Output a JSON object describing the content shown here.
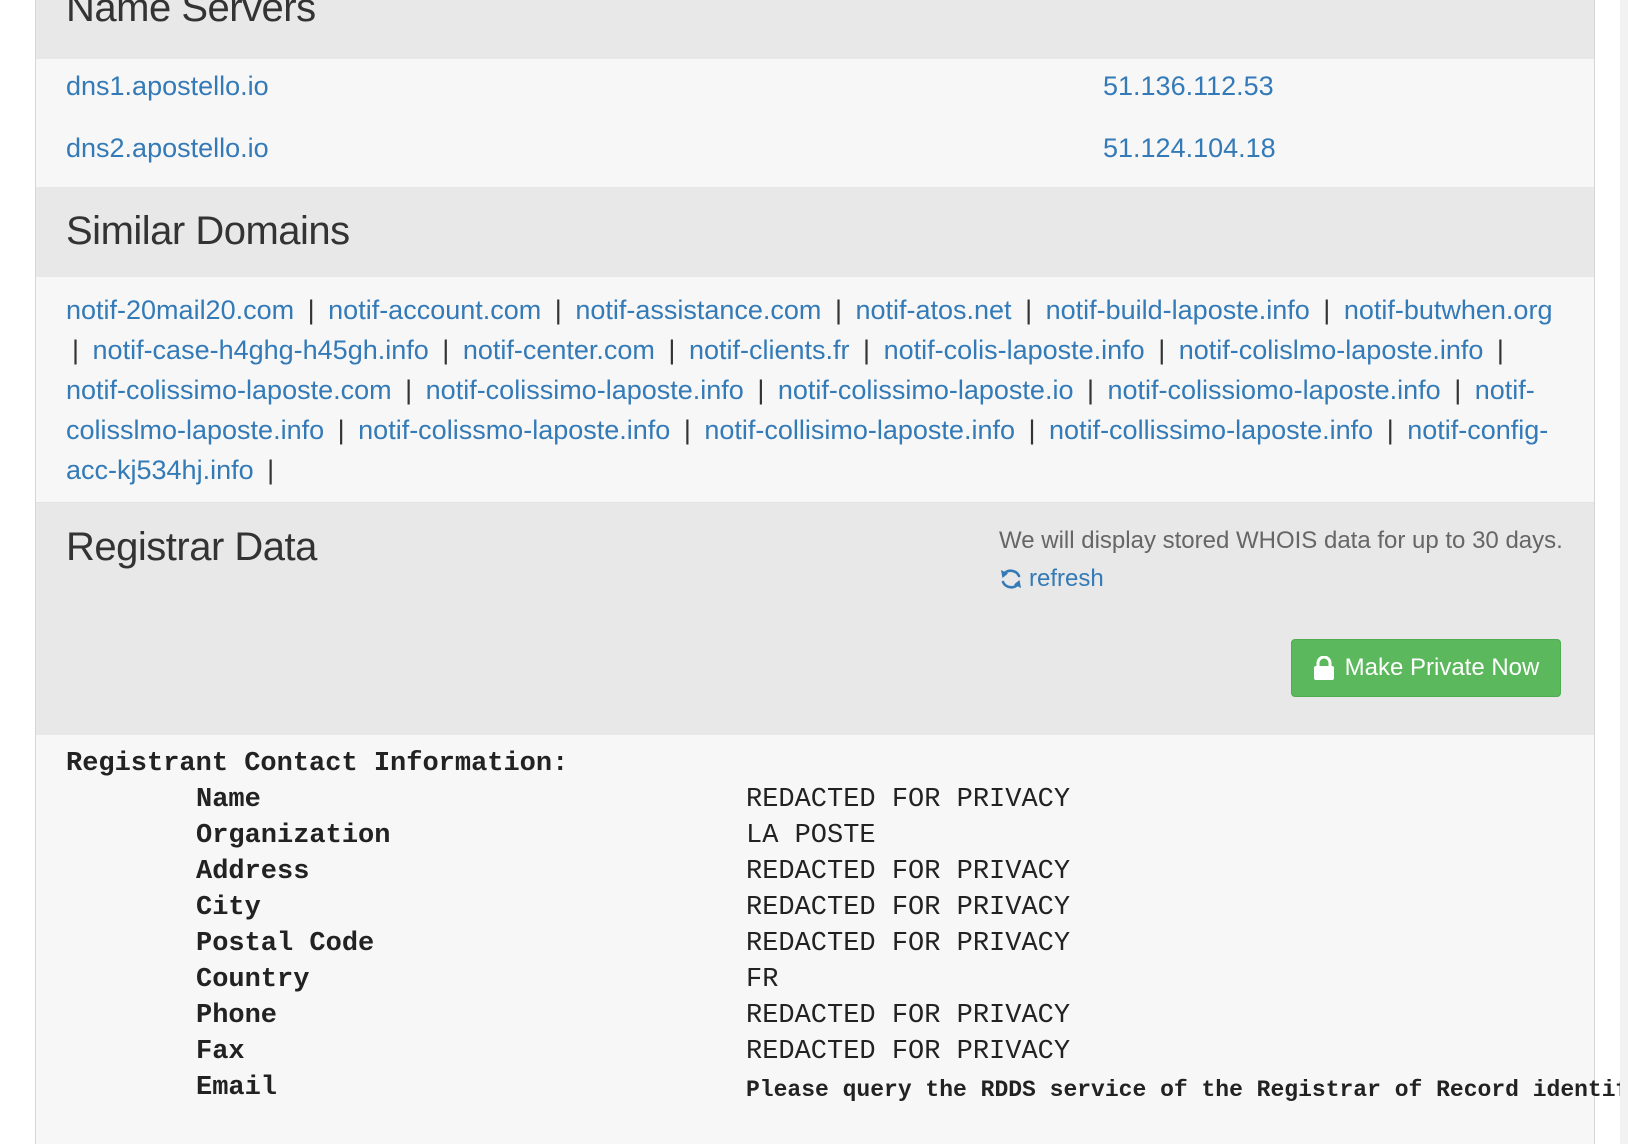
{
  "name_servers": {
    "title": "Name Servers",
    "rows": [
      {
        "host": "dns1.apostello.io",
        "ip": "51.136.112.53"
      },
      {
        "host": "dns2.apostello.io",
        "ip": "51.124.104.18"
      }
    ]
  },
  "similar_domains": {
    "title": "Similar Domains",
    "separator": "|",
    "items": [
      "notif-20mail20.com",
      "notif-account.com",
      "notif-assistance.com",
      "notif-atos.net",
      "notif-build-laposte.info",
      "notif-butwhen.org",
      "notif-case-h4ghg-h45gh.info",
      "notif-center.com",
      "notif-clients.fr",
      "notif-colis-laposte.info",
      "notif-colislmo-laposte.info",
      "notif-colissimo-laposte.com",
      "notif-colissimo-laposte.info",
      "notif-colissimo-laposte.io",
      "notif-colissiomo-laposte.info",
      "notif-colisslmo-laposte.info",
      "notif-colissmo-laposte.info",
      "notif-collisimo-laposte.info",
      "notif-collissimo-laposte.info",
      "notif-config-acc-kj534hj.info"
    ]
  },
  "registrar": {
    "title": "Registrar Data",
    "note": "We will display stored WHOIS data for up to 30 days.",
    "refresh_label": "refresh",
    "private_button_label": "Make Private Now",
    "refresh_icon": "refresh-icon",
    "lock_icon": "lock-icon",
    "button_color": "#5cb85c"
  },
  "whois": {
    "header": "Registrant Contact Information:",
    "rows": [
      {
        "key": "Name",
        "value": "REDACTED FOR PRIVACY"
      },
      {
        "key": "Organization",
        "value": "LA POSTE"
      },
      {
        "key": "Address",
        "value": "REDACTED FOR PRIVACY"
      },
      {
        "key": "City",
        "value": "REDACTED FOR PRIVACY"
      },
      {
        "key": "Postal Code",
        "value": "REDACTED FOR PRIVACY"
      },
      {
        "key": "Country",
        "value": "FR"
      },
      {
        "key": "Phone",
        "value": "REDACTED FOR PRIVACY"
      },
      {
        "key": "Fax",
        "value": "REDACTED FOR PRIVACY"
      },
      {
        "key": "Email",
        "value": "Please query the RDDS service of the Registrar of Record identifie"
      }
    ]
  }
}
